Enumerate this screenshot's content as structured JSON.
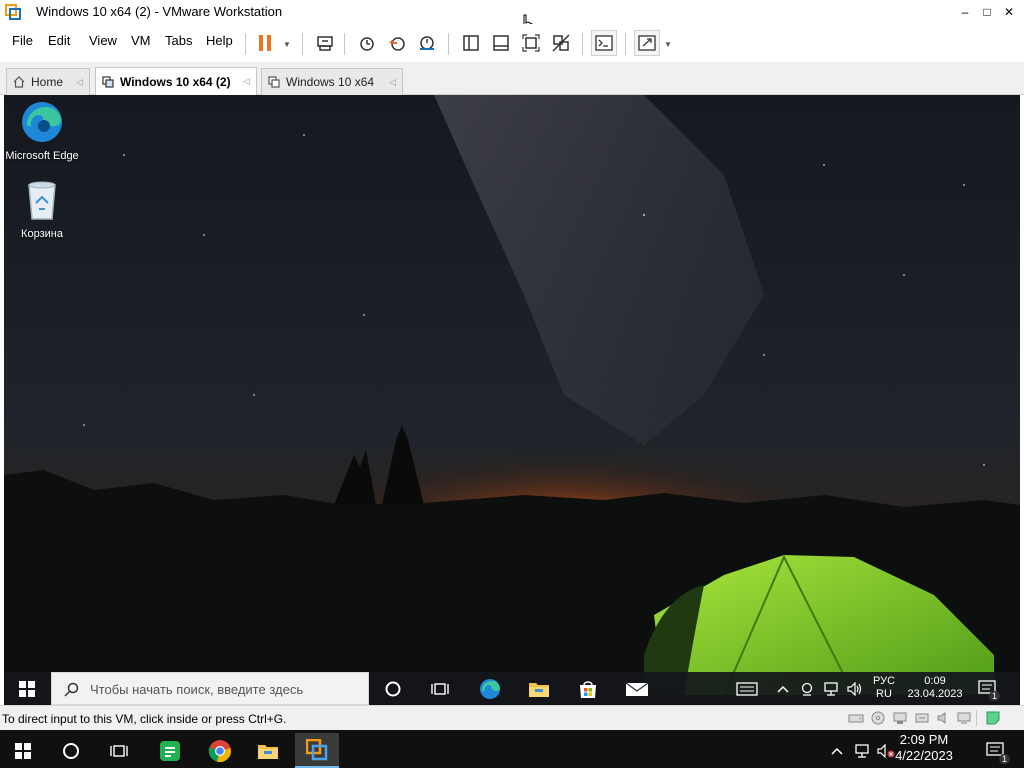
{
  "window": {
    "title": "Windows 10 x64 (2) - VMware Workstation",
    "minimize": "–",
    "maximize": "□",
    "close": "✕"
  },
  "menu": {
    "items": [
      "File",
      "Edit",
      "View",
      "VM",
      "Tabs",
      "Help"
    ]
  },
  "toolbar": {
    "icons": [
      "pause-icon",
      "dropdown-arrow-icon",
      "send-ctrl-alt-del-icon",
      "snapshot-icon",
      "revert-snapshot-icon",
      "snapshot-manager-icon",
      "show-library-icon",
      "thumbnail-bar-icon",
      "fit-guest-icon",
      "unity-icon",
      "console-view-icon",
      "full-screen-icon",
      "dropdown-arrow-icon"
    ],
    "accent": "#e87722"
  },
  "tabs": [
    {
      "label": "Home",
      "active": false
    },
    {
      "label": "Windows 10 x64 (2)",
      "active": true
    },
    {
      "label": "Windows 10 x64",
      "active": false
    }
  ],
  "guest": {
    "desktop_icons": [
      {
        "label": "Microsoft Edge",
        "icon": "edge-icon"
      },
      {
        "label": "Корзина",
        "icon": "recycle-bin-icon"
      }
    ],
    "taskbar": {
      "search_placeholder": "Чтобы начать поиск, введите здесь",
      "pinned": [
        "cortana-icon",
        "task-view-icon",
        "edge-icon",
        "file-explorer-icon",
        "store-icon",
        "mail-icon"
      ],
      "lang_top": "РУС",
      "lang_bottom": "RU",
      "time": "0:09",
      "date": "23.04.2023",
      "notifications": "1"
    }
  },
  "statusbar": {
    "message": "To direct input to this VM, click inside or press Ctrl+G."
  },
  "host_taskbar": {
    "apps": [
      "windows-start-icon",
      "search-circle-icon",
      "task-view-icon",
      "sheets-icon",
      "chrome-icon",
      "file-explorer-icon",
      "vmware-icon"
    ],
    "time": "2:09 PM",
    "date": "4/22/2023",
    "notifications": "1"
  }
}
